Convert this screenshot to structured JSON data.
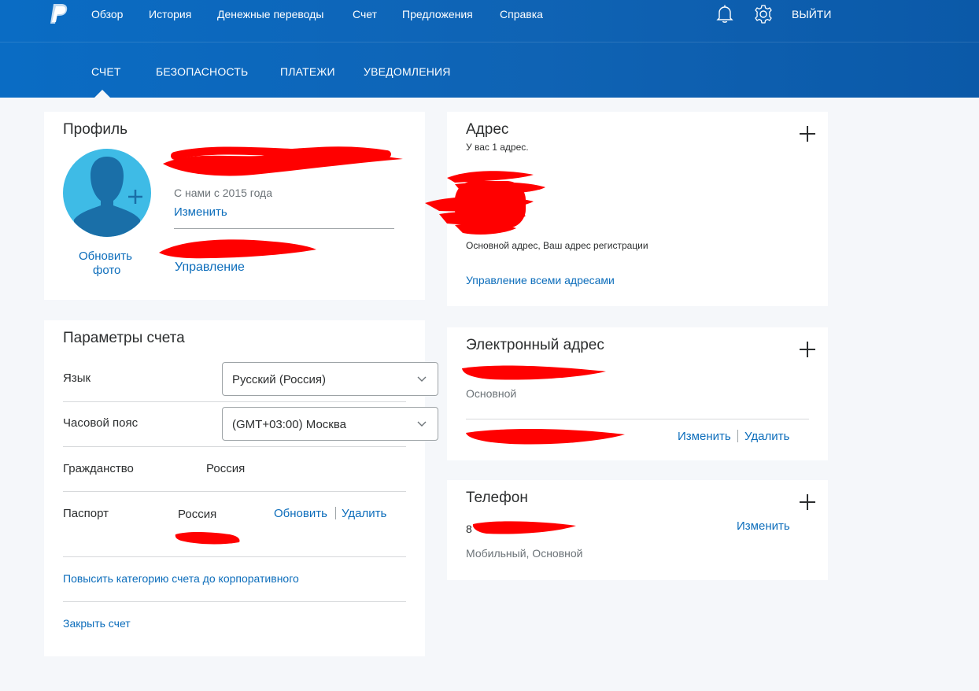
{
  "header": {
    "nav": [
      "Обзор",
      "История",
      "Денежные переводы",
      "Счет",
      "Предложения",
      "Справка"
    ],
    "logout": "ВЫЙТИ",
    "icons": [
      "bell-icon",
      "gear-icon"
    ],
    "colors": {
      "brand": "#0a6cc4",
      "link": "#0c6dbb",
      "redaction": "#ff0000"
    }
  },
  "subnav": [
    "СЧЕТ",
    "БЕЗОПАСНОСТЬ",
    "ПЛАТЕЖИ",
    "УВЕДОМЛЕНИЯ"
  ],
  "profile": {
    "title": "Профиль",
    "member_since": "С нами с 2015 года",
    "edit_link": "Изменить",
    "update_photo_line1": "Обновить",
    "update_photo_line2": "фото",
    "manage_link": "Управление"
  },
  "account_settings": {
    "title": "Параметры счета",
    "language_label": "Язык",
    "language_value": "Русский (Россия)",
    "timezone_label": "Часовой пояс",
    "timezone_value": "(GMT+03:00) Москва",
    "citizenship_label": "Гражданство",
    "citizenship_value": "Россия",
    "passport_label": "Паспорт",
    "passport_value": "Россия",
    "passport_update": "Обновить",
    "passport_delete": "Удалить",
    "upgrade_link": "Повысить категорию счета до корпоративного",
    "close_link": "Закрыть счет"
  },
  "address": {
    "title": "Адрес",
    "count_text": "У вас 1 адрес.",
    "type_text": "Основной адрес, Ваш адрес регистрации",
    "manage_link": "Управление всеми адресами"
  },
  "email": {
    "title": "Электронный адрес",
    "primary_text": "Основной",
    "edit_link": "Изменить",
    "delete_link": "Удалить"
  },
  "phone": {
    "title": "Телефон",
    "number_prefix": "8",
    "type_text": "Мобильный, Основной",
    "edit_link": "Изменить"
  }
}
